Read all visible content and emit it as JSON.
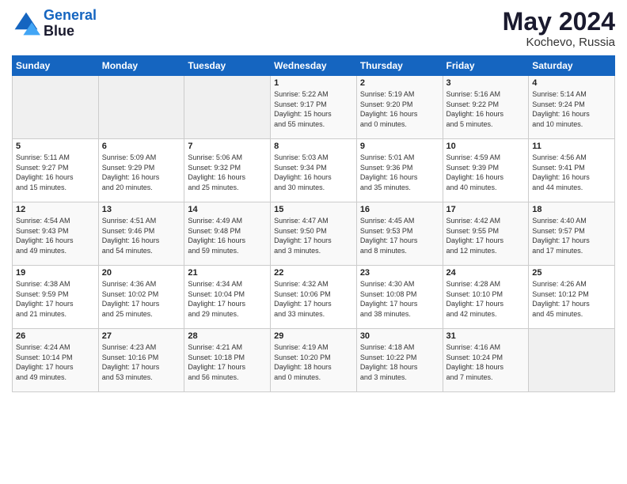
{
  "header": {
    "logo_line1": "General",
    "logo_line2": "Blue",
    "month": "May 2024",
    "location": "Kochevo, Russia"
  },
  "weekdays": [
    "Sunday",
    "Monday",
    "Tuesday",
    "Wednesday",
    "Thursday",
    "Friday",
    "Saturday"
  ],
  "weeks": [
    [
      {
        "day": "",
        "content": ""
      },
      {
        "day": "",
        "content": ""
      },
      {
        "day": "",
        "content": ""
      },
      {
        "day": "1",
        "content": "Sunrise: 5:22 AM\nSunset: 9:17 PM\nDaylight: 15 hours\nand 55 minutes."
      },
      {
        "day": "2",
        "content": "Sunrise: 5:19 AM\nSunset: 9:20 PM\nDaylight: 16 hours\nand 0 minutes."
      },
      {
        "day": "3",
        "content": "Sunrise: 5:16 AM\nSunset: 9:22 PM\nDaylight: 16 hours\nand 5 minutes."
      },
      {
        "day": "4",
        "content": "Sunrise: 5:14 AM\nSunset: 9:24 PM\nDaylight: 16 hours\nand 10 minutes."
      }
    ],
    [
      {
        "day": "5",
        "content": "Sunrise: 5:11 AM\nSunset: 9:27 PM\nDaylight: 16 hours\nand 15 minutes."
      },
      {
        "day": "6",
        "content": "Sunrise: 5:09 AM\nSunset: 9:29 PM\nDaylight: 16 hours\nand 20 minutes."
      },
      {
        "day": "7",
        "content": "Sunrise: 5:06 AM\nSunset: 9:32 PM\nDaylight: 16 hours\nand 25 minutes."
      },
      {
        "day": "8",
        "content": "Sunrise: 5:03 AM\nSunset: 9:34 PM\nDaylight: 16 hours\nand 30 minutes."
      },
      {
        "day": "9",
        "content": "Sunrise: 5:01 AM\nSunset: 9:36 PM\nDaylight: 16 hours\nand 35 minutes."
      },
      {
        "day": "10",
        "content": "Sunrise: 4:59 AM\nSunset: 9:39 PM\nDaylight: 16 hours\nand 40 minutes."
      },
      {
        "day": "11",
        "content": "Sunrise: 4:56 AM\nSunset: 9:41 PM\nDaylight: 16 hours\nand 44 minutes."
      }
    ],
    [
      {
        "day": "12",
        "content": "Sunrise: 4:54 AM\nSunset: 9:43 PM\nDaylight: 16 hours\nand 49 minutes."
      },
      {
        "day": "13",
        "content": "Sunrise: 4:51 AM\nSunset: 9:46 PM\nDaylight: 16 hours\nand 54 minutes."
      },
      {
        "day": "14",
        "content": "Sunrise: 4:49 AM\nSunset: 9:48 PM\nDaylight: 16 hours\nand 59 minutes."
      },
      {
        "day": "15",
        "content": "Sunrise: 4:47 AM\nSunset: 9:50 PM\nDaylight: 17 hours\nand 3 minutes."
      },
      {
        "day": "16",
        "content": "Sunrise: 4:45 AM\nSunset: 9:53 PM\nDaylight: 17 hours\nand 8 minutes."
      },
      {
        "day": "17",
        "content": "Sunrise: 4:42 AM\nSunset: 9:55 PM\nDaylight: 17 hours\nand 12 minutes."
      },
      {
        "day": "18",
        "content": "Sunrise: 4:40 AM\nSunset: 9:57 PM\nDaylight: 17 hours\nand 17 minutes."
      }
    ],
    [
      {
        "day": "19",
        "content": "Sunrise: 4:38 AM\nSunset: 9:59 PM\nDaylight: 17 hours\nand 21 minutes."
      },
      {
        "day": "20",
        "content": "Sunrise: 4:36 AM\nSunset: 10:02 PM\nDaylight: 17 hours\nand 25 minutes."
      },
      {
        "day": "21",
        "content": "Sunrise: 4:34 AM\nSunset: 10:04 PM\nDaylight: 17 hours\nand 29 minutes."
      },
      {
        "day": "22",
        "content": "Sunrise: 4:32 AM\nSunset: 10:06 PM\nDaylight: 17 hours\nand 33 minutes."
      },
      {
        "day": "23",
        "content": "Sunrise: 4:30 AM\nSunset: 10:08 PM\nDaylight: 17 hours\nand 38 minutes."
      },
      {
        "day": "24",
        "content": "Sunrise: 4:28 AM\nSunset: 10:10 PM\nDaylight: 17 hours\nand 42 minutes."
      },
      {
        "day": "25",
        "content": "Sunrise: 4:26 AM\nSunset: 10:12 PM\nDaylight: 17 hours\nand 45 minutes."
      }
    ],
    [
      {
        "day": "26",
        "content": "Sunrise: 4:24 AM\nSunset: 10:14 PM\nDaylight: 17 hours\nand 49 minutes."
      },
      {
        "day": "27",
        "content": "Sunrise: 4:23 AM\nSunset: 10:16 PM\nDaylight: 17 hours\nand 53 minutes."
      },
      {
        "day": "28",
        "content": "Sunrise: 4:21 AM\nSunset: 10:18 PM\nDaylight: 17 hours\nand 56 minutes."
      },
      {
        "day": "29",
        "content": "Sunrise: 4:19 AM\nSunset: 10:20 PM\nDaylight: 18 hours\nand 0 minutes."
      },
      {
        "day": "30",
        "content": "Sunrise: 4:18 AM\nSunset: 10:22 PM\nDaylight: 18 hours\nand 3 minutes."
      },
      {
        "day": "31",
        "content": "Sunrise: 4:16 AM\nSunset: 10:24 PM\nDaylight: 18 hours\nand 7 minutes."
      },
      {
        "day": "",
        "content": ""
      }
    ]
  ]
}
